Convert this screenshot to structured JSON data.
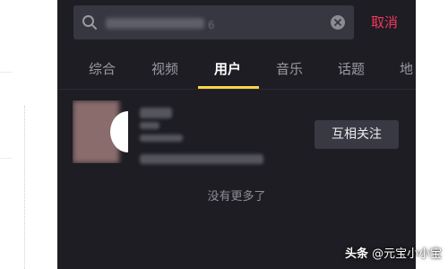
{
  "search": {
    "value_hint": "6",
    "cancel_label": "取消"
  },
  "tabs": [
    {
      "label": "综合",
      "active": false
    },
    {
      "label": "视频",
      "active": false
    },
    {
      "label": "用户",
      "active": true
    },
    {
      "label": "音乐",
      "active": false
    },
    {
      "label": "话题",
      "active": false
    },
    {
      "label": "地",
      "active": false
    }
  ],
  "result": {
    "follow_label": "互相关注"
  },
  "footer": {
    "no_more_text": "没有更多了"
  },
  "watermark": {
    "brand": "头条",
    "handle": "@元宝小小宝"
  },
  "colors": {
    "background": "#1d1d23",
    "accent": "#f4385d",
    "tab_indicator": "#f9d24a"
  }
}
